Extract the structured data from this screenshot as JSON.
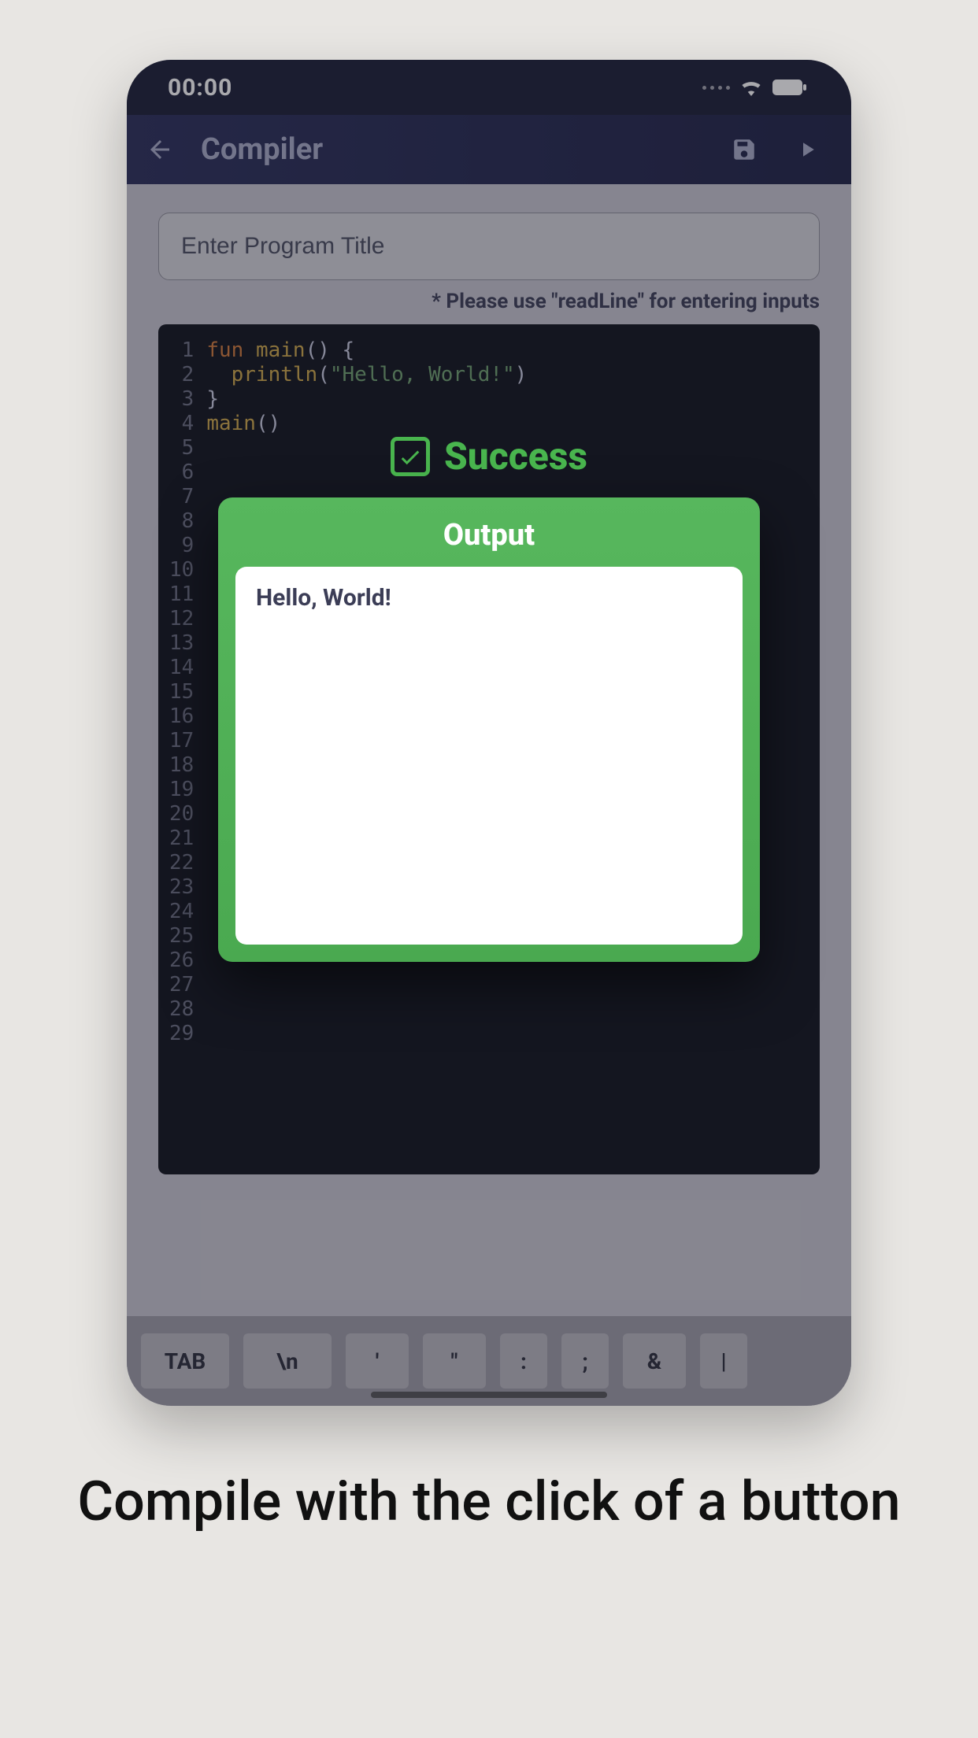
{
  "statusbar": {
    "time": "00:00"
  },
  "appbar": {
    "title": "Compiler",
    "back_icon": "arrow-left",
    "save_icon": "save",
    "run_icon": "play"
  },
  "title_input": {
    "placeholder": "Enter Program Title",
    "value": ""
  },
  "hint": "* Please use \"readLine\" for entering inputs",
  "code": {
    "total_lines": 29,
    "lines": [
      {
        "n": 1,
        "tokens": [
          [
            "kw",
            "fun "
          ],
          [
            "fn",
            "main"
          ],
          [
            "",
            "() {"
          ]
        ]
      },
      {
        "n": 2,
        "tokens": [
          [
            "",
            "  "
          ],
          [
            "fn",
            "println"
          ],
          [
            "",
            "("
          ],
          [
            "str",
            "\"Hello, World!\""
          ],
          [
            "",
            ")"
          ]
        ]
      },
      {
        "n": 3,
        "tokens": [
          [
            "",
            "}"
          ]
        ]
      },
      {
        "n": 4,
        "tokens": [
          [
            "fn",
            "main"
          ],
          [
            "",
            "()"
          ]
        ]
      }
    ]
  },
  "keys": [
    "TAB",
    "\\n",
    "'",
    "\"",
    ":",
    ";",
    "&",
    "|"
  ],
  "modal": {
    "status_label": "Success",
    "title": "Output",
    "output_text": "Hello, World!"
  },
  "caption": "Compile with the click of a button"
}
